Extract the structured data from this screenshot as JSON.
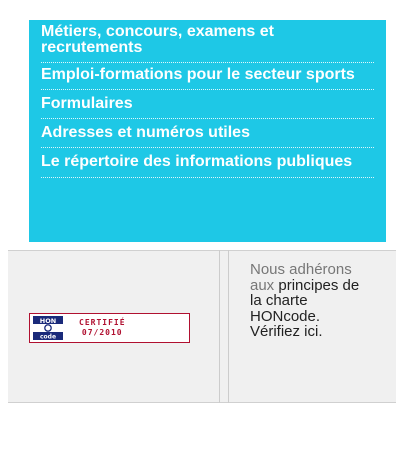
{
  "menu": {
    "background_color": "#1ec8e6",
    "items": [
      {
        "label": "Métiers, concours, examens et recrutements"
      },
      {
        "label": "Emploi-formations pour le secteur sports"
      },
      {
        "label": "Formulaires"
      },
      {
        "label": "Adresses et numéros utiles"
      },
      {
        "label": "Le répertoire des informations publiques"
      }
    ]
  },
  "honcode_seal": {
    "logo_text_top": "HON",
    "logo_text_bottom": "code",
    "status": "CERTIFIÉ",
    "date": "07/2010",
    "accent_color": "#b01030"
  },
  "honcode_info": {
    "text_intro": "Nous adhérons aux",
    "text_link": "principes de la charte HONcode. Vérifiez ici."
  }
}
